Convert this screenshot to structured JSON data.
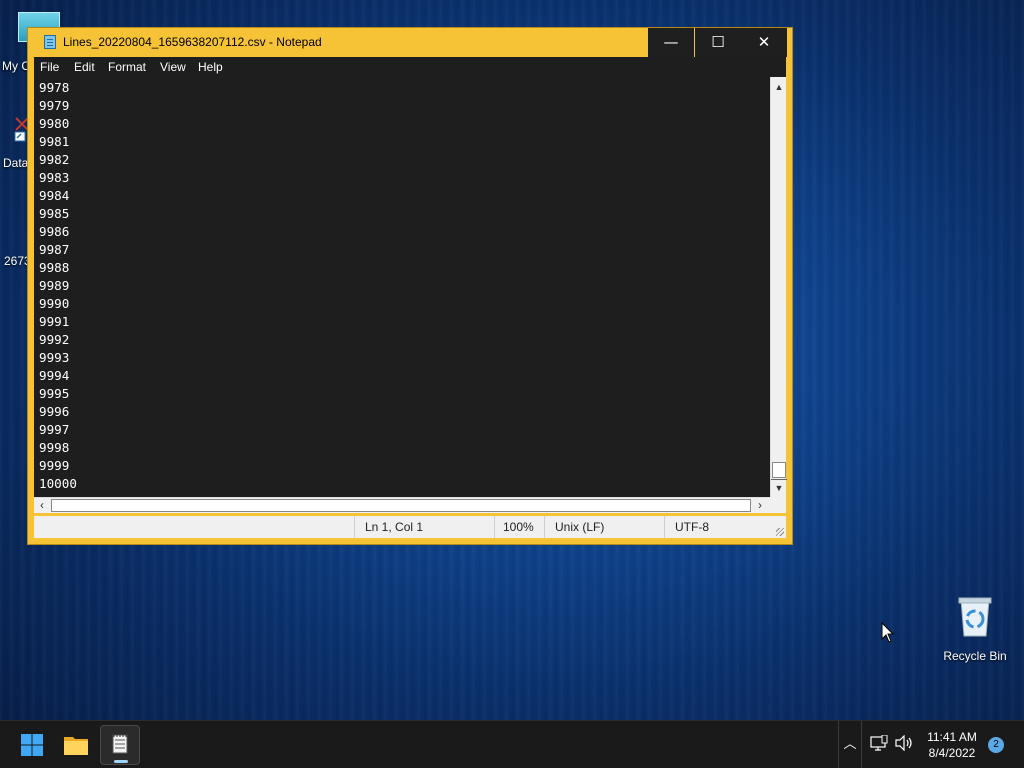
{
  "desktop": {
    "icons": [
      {
        "label": "My C"
      },
      {
        "label": "Data"
      },
      {
        "label": "2673"
      },
      {
        "label": "Recycle Bin"
      }
    ]
  },
  "notepad": {
    "title": "Lines_20220804_1659638207112.csv - Notepad",
    "controls": {
      "minimize": "—",
      "maximize": "☐",
      "close": "✕"
    },
    "menu": [
      "File",
      "Edit",
      "Format",
      "View",
      "Help"
    ],
    "lines": [
      "9978",
      "9979",
      "9980",
      "9981",
      "9982",
      "9983",
      "9984",
      "9985",
      "9986",
      "9987",
      "9988",
      "9989",
      "9990",
      "9991",
      "9992",
      "9993",
      "9994",
      "9995",
      "9996",
      "9997",
      "9998",
      "9999",
      "10000"
    ],
    "status": {
      "position": "Ln 1, Col 1",
      "zoom": "100%",
      "line_ending": "Unix (LF)",
      "encoding": "UTF-8"
    },
    "colors": {
      "frame": "#f6c236",
      "editor_bg": "#1e1e1e"
    }
  },
  "taskbar": {
    "time": "11:41 AM",
    "date": "8/4/2022",
    "notification_count": "2",
    "icons": [
      "windows-start-icon",
      "file-explorer-icon",
      "notepad-icon",
      "chevron-up-icon",
      "network-icon",
      "volume-icon"
    ]
  }
}
